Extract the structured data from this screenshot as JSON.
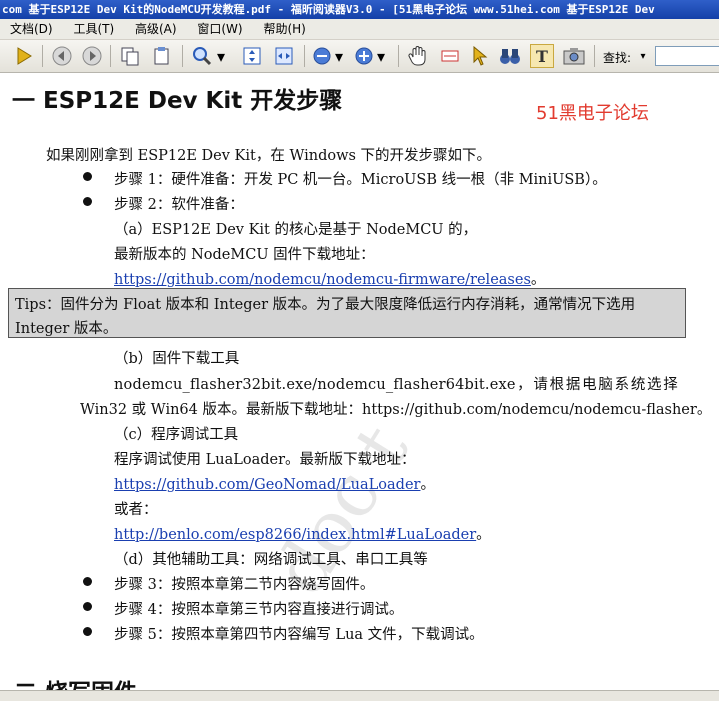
{
  "window": {
    "title": "com 基于ESP12E Dev Kit的NodeMCU开发教程.pdf - 福昕阅读器V3.0 - [51黑电子论坛 www.51hei.com 基于ESP12E Dev"
  },
  "menu": [
    "文档(D)",
    "工具(T)",
    "高级(A)",
    "窗口(W)",
    "帮助(H)"
  ],
  "toolbar": {
    "find_label": "查找:",
    "find_value": ""
  },
  "document": {
    "heading": "一  ESP12E Dev Kit 开发步骤",
    "forum_mark": "51黑电子论坛",
    "intro": "如果刚刚拿到 ESP12E Dev Kit，在 Windows 下的开发步骤如下。",
    "step1": "步骤 1：硬件准备：开发 PC 机一台。MicroUSB 线一根（非 MiniUSB）。",
    "step2": "步骤 2：软件准备：",
    "a_line": "（a）ESP12E Dev Kit 的核心是基于 NodeMCU 的，",
    "a_line2": "最新版本的 NodeMCU 固件下载地址：",
    "a_link": "https://github.com/nodemcu/nodemcu-firmware/releases",
    "a_link_suffix": "。",
    "tips": "Tips：固件分为 Float 版本和 Integer 版本。为了最大限度降低运行内存消耗，通常情况下选用 Integer 版本。",
    "b_line": "（b）固件下载工具",
    "b_line2": "nodemcu_flasher32bit.exe/nodemcu_flasher64bit.exe，请根据电脑系统选择",
    "b_line3": "Win32 或 Win64 版本。最新版下载地址：https://github.com/nodemcu/nodemcu-flasher。",
    "c_line": "（c）程序调试工具",
    "c_line2": "程序调试使用 LuaLoader。最新版下载地址：",
    "c_link": "https://github.com/GeoNomad/LuaLoader",
    "c_link_suffix": "。",
    "or_text": "或者：",
    "c_link2": "http://benlo.com/esp8266/index.html#LuaLoader",
    "c_link2_suffix": "。",
    "d_line": "（d）其他辅助工具：网络调试工具、串口工具等",
    "step3": "步骤 3：按照本章第二节内容烧写固件。",
    "step4": "步骤 4：按照本章第三节内容直接进行调试。",
    "step5": "步骤 5：按照本章第四节内容编写 Lua 文件，下载调试。",
    "heading2": "二  烧写固件"
  }
}
